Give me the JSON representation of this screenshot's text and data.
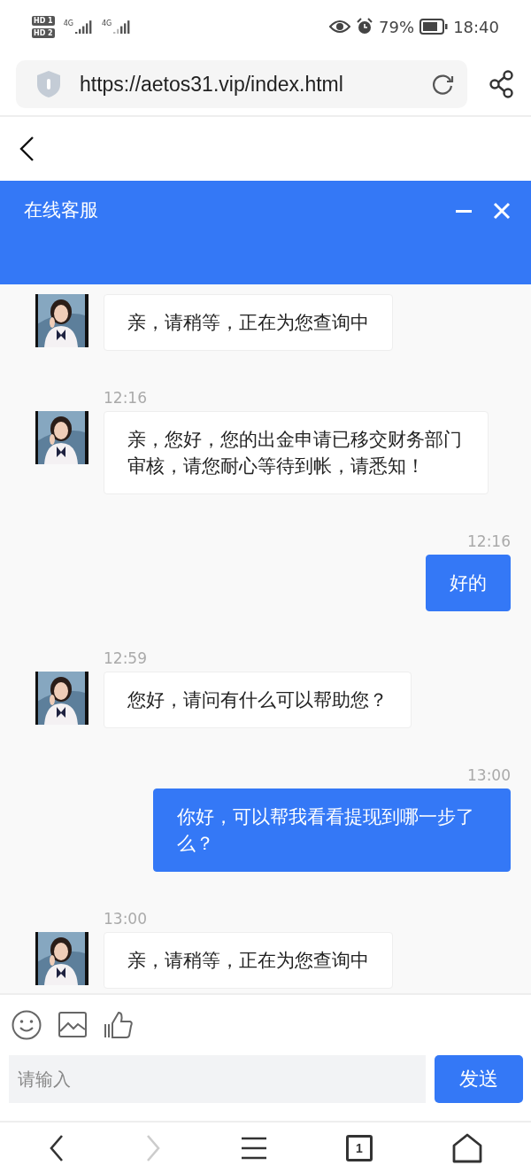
{
  "status_bar": {
    "sim_labels": [
      "HD 1",
      "HD 2"
    ],
    "network_labels": [
      "4G",
      "4G"
    ],
    "battery_percent": "79%",
    "time": "18:40"
  },
  "address_bar": {
    "url": "https://aetos31.vip/index.html"
  },
  "chat": {
    "title": "在线客服",
    "messages": [
      {
        "kind": "agent",
        "text": "亲，请稍等，正在为您查询中"
      },
      {
        "kind": "agent",
        "time": "12:16",
        "text": "亲，您好，您的出金申请已移交财务部门审核，请您耐心等待到帐，请悉知！"
      },
      {
        "kind": "user",
        "time": "12:16",
        "text": "好的"
      },
      {
        "kind": "agent",
        "time": "12:59",
        "text": "您好，请问有什么可以帮助您？"
      },
      {
        "kind": "user",
        "time": "13:00",
        "text": "你好，可以帮我看看提现到哪一步了么？"
      },
      {
        "kind": "agent",
        "time": "13:00",
        "text": "亲，请稍等，正在为您查询中"
      }
    ],
    "input": {
      "placeholder": "请输入"
    },
    "send_button": "发送"
  },
  "nav_bar": {
    "tab_count": "1",
    "forward_disabled": true
  }
}
